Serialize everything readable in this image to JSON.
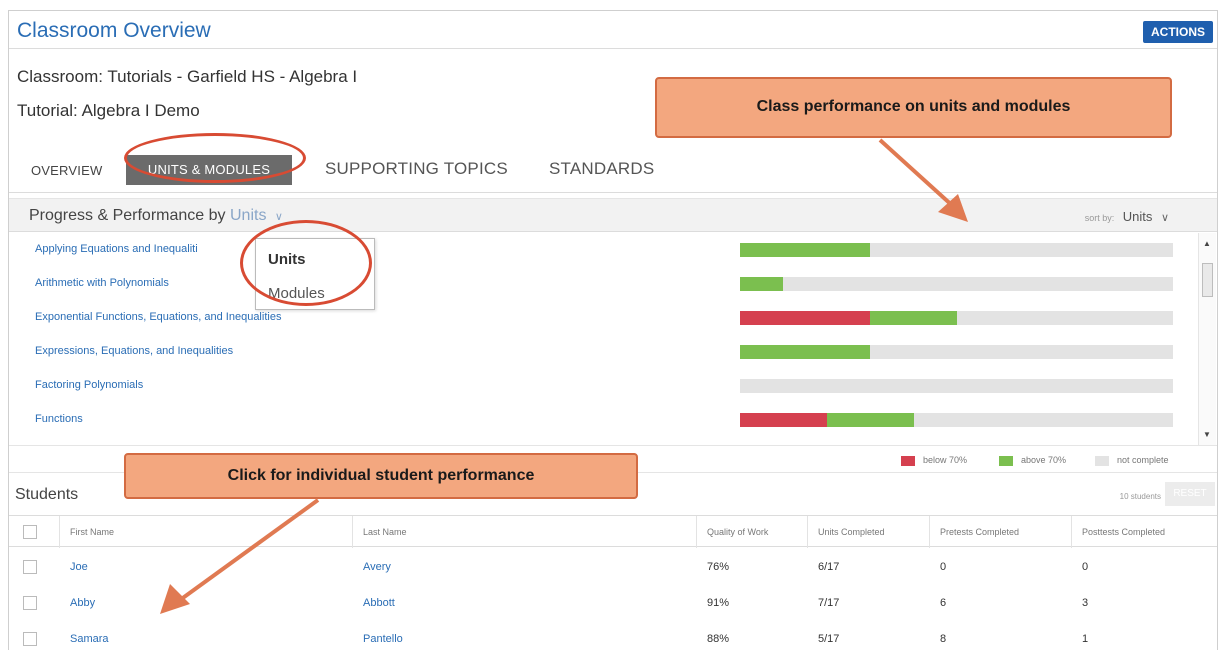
{
  "header": {
    "title": "Classroom Overview",
    "actions_label": "ACTIONS"
  },
  "meta": {
    "classroom": "Classroom: Tutorials - Garfield HS - Algebra I",
    "tutorial": "Tutorial: Algebra I Demo"
  },
  "tabs": [
    {
      "label": "OVERVIEW"
    },
    {
      "label": "UNITS & MODULES",
      "active": true
    },
    {
      "label": "SUPPORTING TOPICS"
    },
    {
      "label": "STANDARDS"
    }
  ],
  "progress": {
    "title": "Progress & Performance by",
    "mode": "Units",
    "sort_label": "sort by:",
    "sort_value": "Units",
    "dropdown_options": [
      "Units",
      "Modules"
    ],
    "units": [
      {
        "name": "Applying Equations and Inequaliti",
        "below70_pct": 0,
        "above70_pct": 30
      },
      {
        "name": "Arithmetic with Polynomials",
        "below70_pct": 0,
        "above70_pct": 10
      },
      {
        "name": "Exponential Functions, Equations, and Inequalities",
        "below70_pct": 30,
        "above70_pct": 20
      },
      {
        "name": "Expressions, Equations, and Inequalities",
        "below70_pct": 0,
        "above70_pct": 30
      },
      {
        "name": "Factoring Polynomials",
        "below70_pct": 0,
        "above70_pct": 0
      },
      {
        "name": "Functions",
        "below70_pct": 20,
        "above70_pct": 20
      }
    ],
    "legend": {
      "below": "below 70%",
      "above": "above 70%",
      "not_complete": "not complete"
    }
  },
  "students": {
    "title": "Students",
    "count": "10 students",
    "reset_label": "RESET",
    "columns": [
      "First Name",
      "Last Name",
      "Quality of Work",
      "Units Completed",
      "Pretests Completed",
      "Posttests Completed"
    ],
    "rows": [
      {
        "first": "Joe",
        "last": "Avery",
        "quality": "76%",
        "units": "6/17",
        "pretests": "0",
        "posttests": "0"
      },
      {
        "first": "Abby",
        "last": "Abbott",
        "quality": "91%",
        "units": "7/17",
        "pretests": "6",
        "posttests": "3"
      },
      {
        "first": "Samara",
        "last": "Pantello",
        "quality": "88%",
        "units": "5/17",
        "pretests": "8",
        "posttests": "1"
      }
    ]
  },
  "callouts": {
    "units_modules": "Class performance on units and modules",
    "student": "Click for individual student performance"
  },
  "colors": {
    "below": "#d5404f",
    "above": "#7bbf4f",
    "not_complete": "#e3e3e3",
    "accent": "#2a6db5",
    "callout": "#f3a77f",
    "annotation": "#d84b33"
  },
  "icons": {
    "mode_chevron": "chevron-down-icon",
    "sort_chevron": "chevron-down-icon",
    "scroll_up": "triangle-up-icon",
    "scroll_down": "triangle-down-icon"
  }
}
